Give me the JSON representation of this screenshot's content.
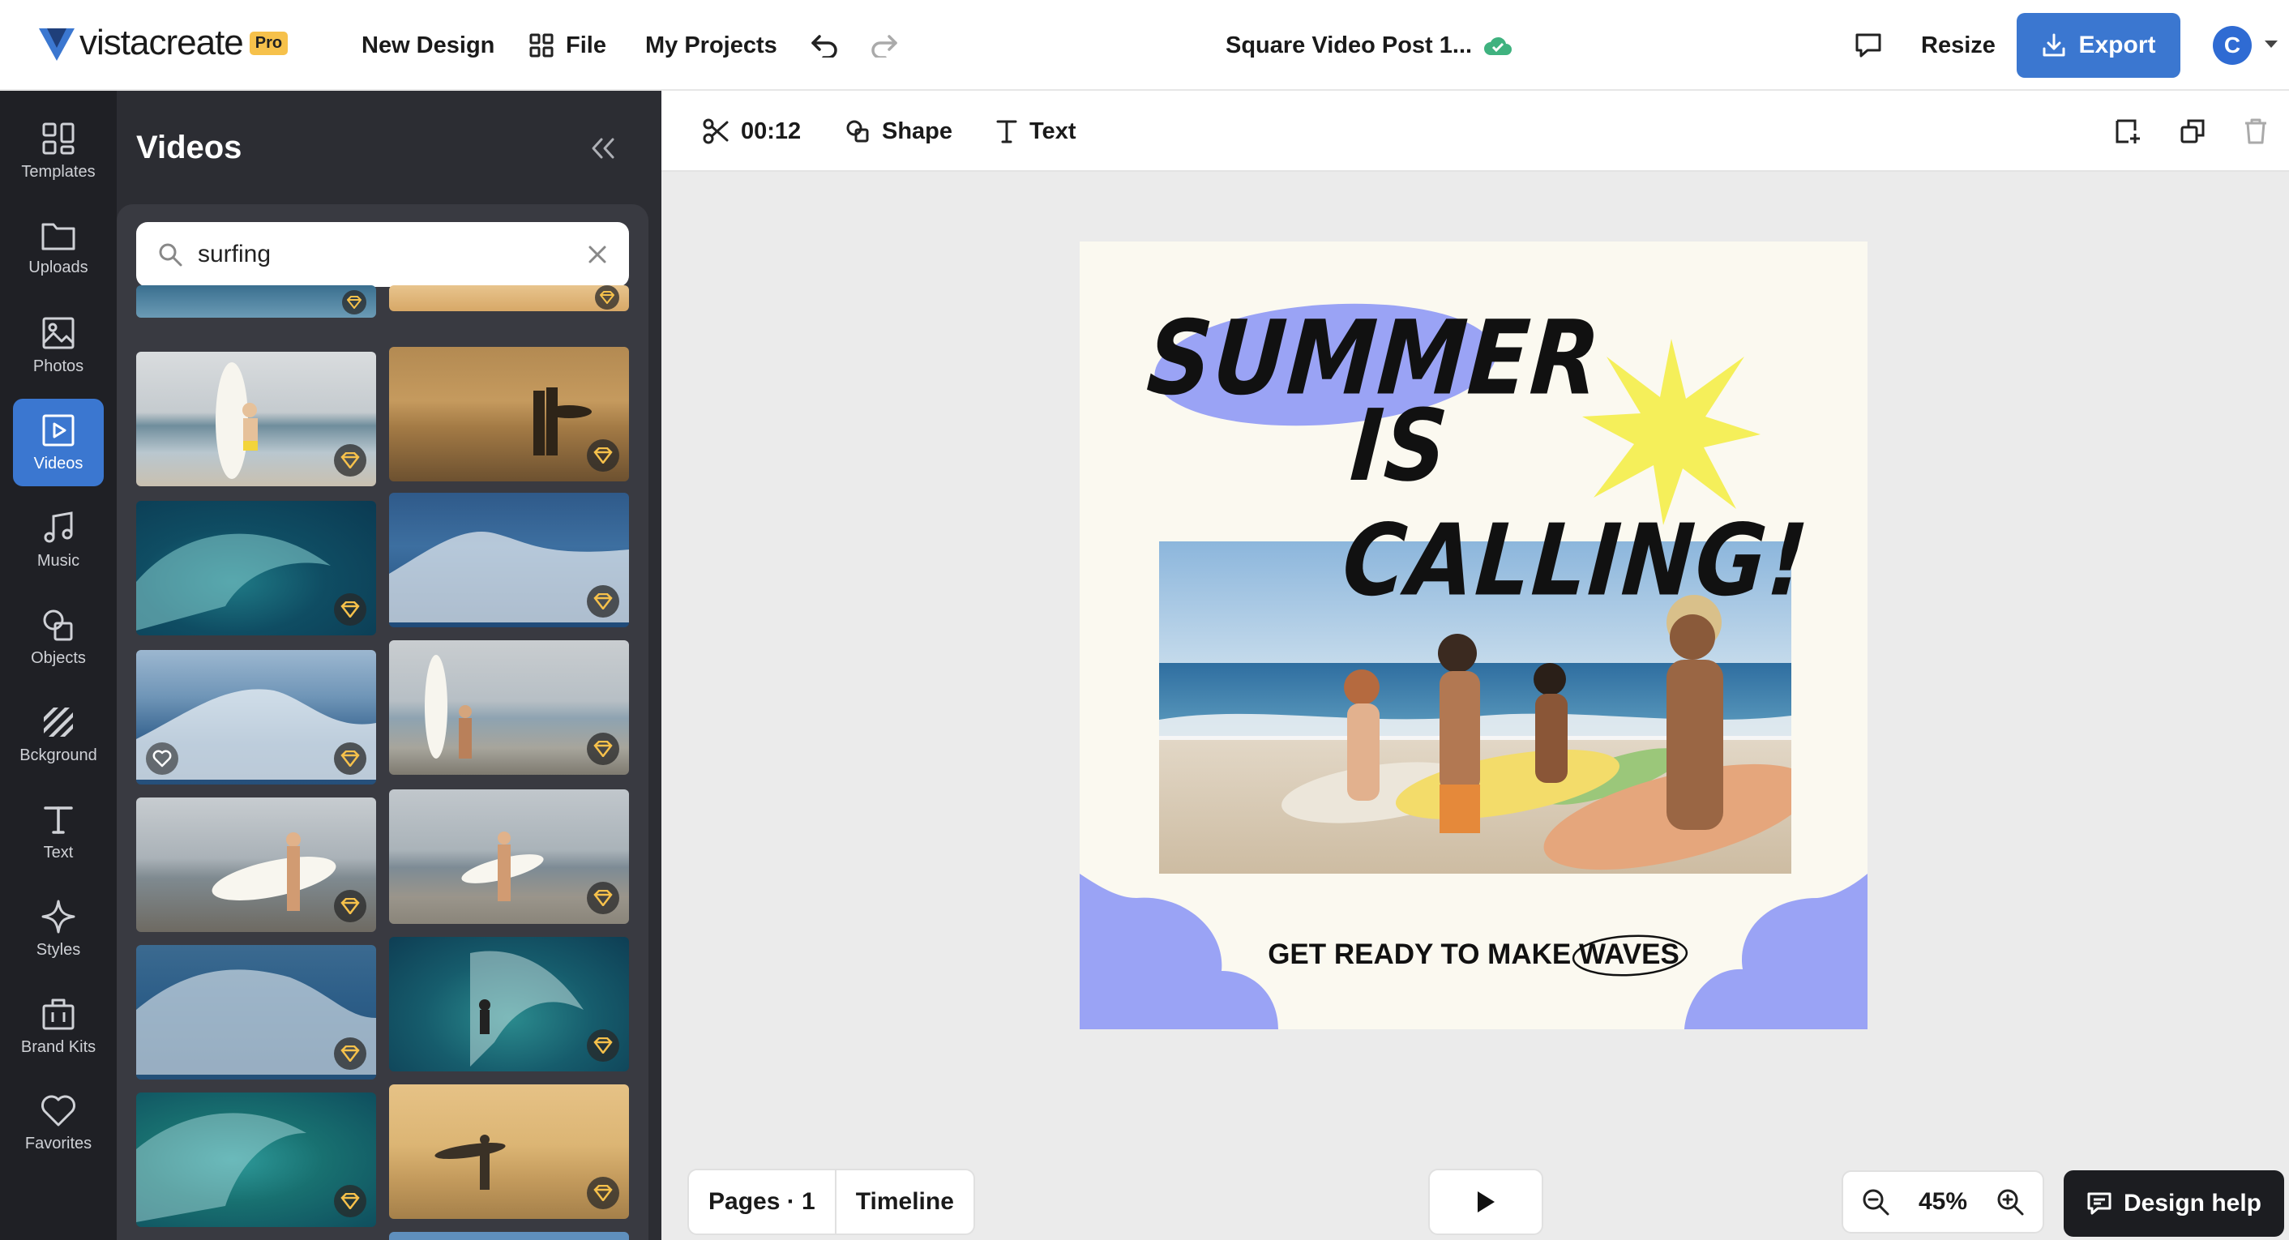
{
  "app": {
    "brand": "vistacreate",
    "badge": "Pro",
    "document_title": "Square Video Post 1...",
    "accent": "#3b77d0"
  },
  "topbar": {
    "new_design": "New Design",
    "file": "File",
    "my_projects": "My Projects",
    "resize": "Resize",
    "export": "Export",
    "avatar_initial": "C"
  },
  "rail": {
    "items": [
      {
        "label": "Templates",
        "icon": "templates-icon"
      },
      {
        "label": "Uploads",
        "icon": "folder-icon"
      },
      {
        "label": "Photos",
        "icon": "image-icon"
      },
      {
        "label": "Videos",
        "icon": "video-icon",
        "active": true
      },
      {
        "label": "Music",
        "icon": "music-icon"
      },
      {
        "label": "Objects",
        "icon": "shapes-icon"
      },
      {
        "label": "Bckground",
        "icon": "background-icon"
      },
      {
        "label": "Text",
        "icon": "text-icon"
      },
      {
        "label": "Styles",
        "icon": "sparkle-icon"
      },
      {
        "label": "Brand Kits",
        "icon": "briefcase-icon"
      },
      {
        "label": "Favorites",
        "icon": "heart-icon"
      }
    ]
  },
  "panel": {
    "title": "Videos",
    "search": {
      "value": "surfing",
      "placeholder": "Search"
    }
  },
  "toolbar": {
    "duration": "00:12",
    "shape": "Shape",
    "text": "Text"
  },
  "canvas": {
    "line1": "SUMMER",
    "line2": "IS CALLING!",
    "tagline_prefix": "GET READY TO MAKE ",
    "tagline_highlight": "WAVES",
    "colors": {
      "blob": "#9aa3f5",
      "star": "#f5ef5a",
      "background": "#fbf9f0"
    }
  },
  "bottom": {
    "pages": "Pages · 1",
    "timeline": "Timeline",
    "zoom": "45%",
    "design_help": "Design help"
  }
}
